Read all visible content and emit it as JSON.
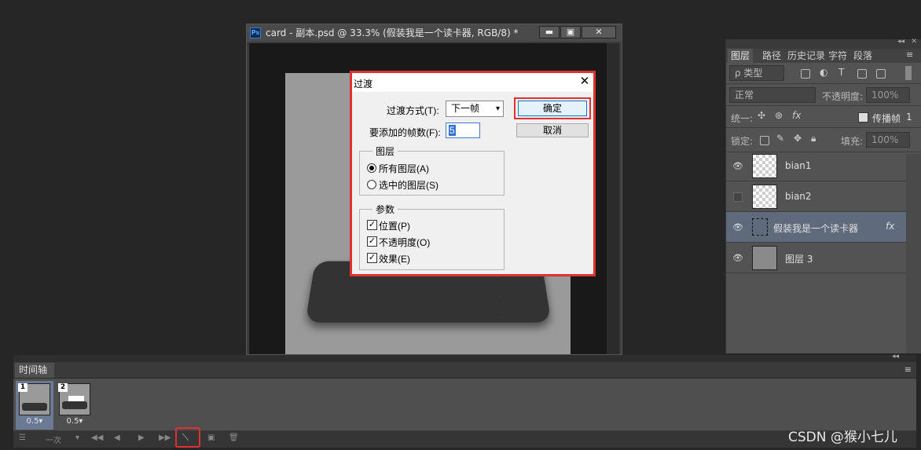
{
  "document": {
    "title": "card - 副本.psd @ 33.3% (假装我是一个读卡器, RGB/8) *",
    "app_icon": "Ps",
    "minimize": "▬",
    "maximize": "▣",
    "close": "✕"
  },
  "dialog": {
    "title": "过渡",
    "close_icon": "✕",
    "method_label": "过渡方式(T):",
    "method_value": "下一帧",
    "frames_label": "要添加的帧数(F):",
    "frames_value": "5",
    "ok_label": "确定",
    "cancel_label": "取消",
    "layers_group": {
      "title": "图层",
      "options": [
        "所有图层(A)",
        "选中的图层(S)"
      ],
      "selected": "所有图层(A)"
    },
    "params_group": {
      "title": "参数",
      "options": [
        {
          "label": "位置(P)",
          "checked": true
        },
        {
          "label": "不透明度(O)",
          "checked": true
        },
        {
          "label": "效果(E)",
          "checked": true
        }
      ]
    }
  },
  "layers_panel": {
    "tabs": [
      "图层",
      "路径",
      "历史记录",
      "字符",
      "段落"
    ],
    "active_tab": "图层",
    "filter_label": "ρ 类型",
    "blend_mode": "正常",
    "opacity_label": "不透明度:",
    "opacity_value": "100%",
    "unify_label": "统一:",
    "propagate_label": "传播帧",
    "propagate_count": "1",
    "lock_label": "锁定:",
    "fill_label": "填充:",
    "fill_value": "100%",
    "layers": [
      {
        "name": "bian1",
        "visible": true,
        "selected": false
      },
      {
        "name": "bian2",
        "visible": false,
        "selected": false
      },
      {
        "name": "假装我是一个读卡器",
        "visible": true,
        "selected": true,
        "fx": "fx"
      },
      {
        "name": "图层 3",
        "visible": true,
        "selected": false
      }
    ]
  },
  "timeline": {
    "tab_label": "时间轴",
    "frames": [
      {
        "number": "1",
        "delay": "0.5▾",
        "selected": true
      },
      {
        "number": "2",
        "delay": "0.5▾",
        "selected": false
      }
    ],
    "loop_label": "一次"
  },
  "watermark": "CSDN @猴小七儿",
  "colors": {
    "highlight": "#e03030",
    "panel": "#535353",
    "selected_layer": "#5f6a7d"
  }
}
